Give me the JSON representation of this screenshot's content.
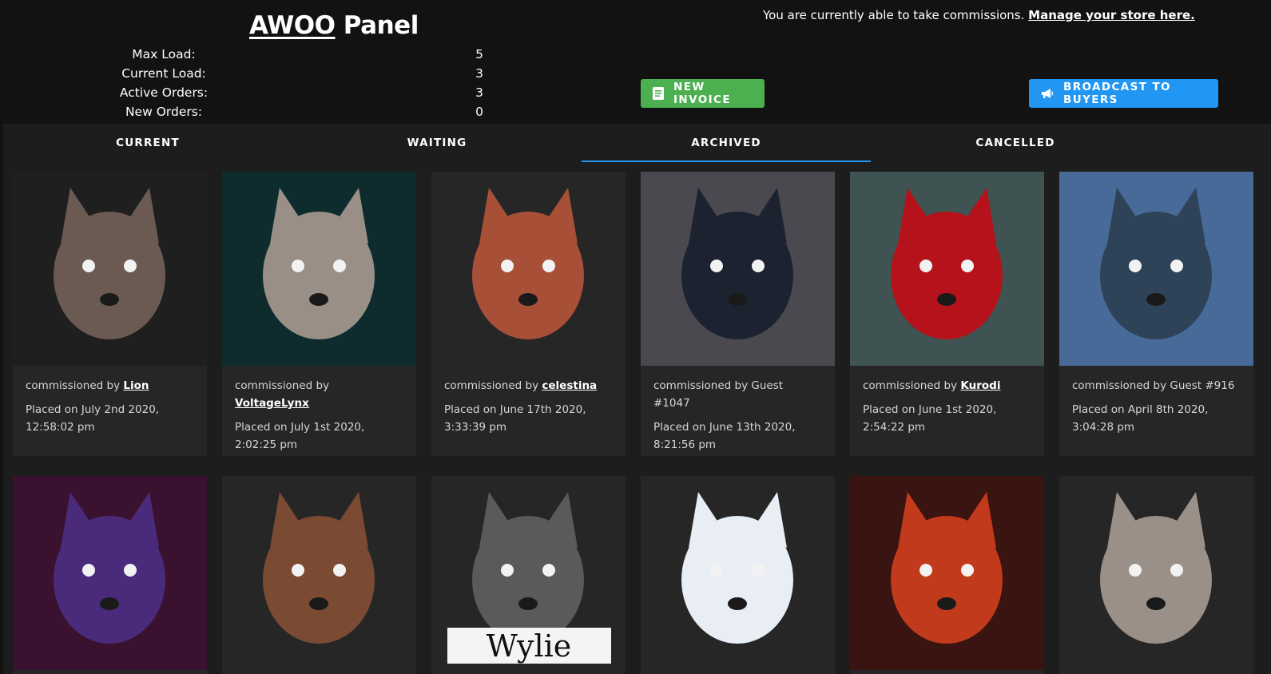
{
  "panel": {
    "brand": "AWOO",
    "title_suffix": " Panel"
  },
  "stats": [
    {
      "label": "Max Load:",
      "value": "5"
    },
    {
      "label": "Current Load:",
      "value": "3"
    },
    {
      "label": "Active Orders:",
      "value": "3"
    },
    {
      "label": "New Orders:",
      "value": "0"
    }
  ],
  "store": {
    "status_text": "You are currently able to take commissions.",
    "link_text": "Manage your store here."
  },
  "buttons": {
    "new_invoice": "NEW INVOICE",
    "broadcast": "BROADCAST TO BUYERS",
    "invoice_color": "#4caf50",
    "broadcast_color": "#2196f3"
  },
  "tabs": [
    {
      "label": "CURRENT",
      "active": false
    },
    {
      "label": "WAITING",
      "active": false
    },
    {
      "label": "ARCHIVED",
      "active": true
    },
    {
      "label": "CANCELLED",
      "active": false
    }
  ],
  "orders_row1": [
    {
      "prefix": "commissioned by",
      "buyer": "Lion",
      "is_guest": false,
      "placed": "Placed on July 2nd 2020, 12:58:02 pm",
      "art": "lion-portrait",
      "bg": "#1f1f1f",
      "fg": "#6b5a52"
    },
    {
      "prefix": "commissioned by",
      "buyer": "VoltageLynx",
      "is_guest": false,
      "placed": "Placed on July 1st 2020, 2:02:25 pm",
      "art": "lynx-portrait",
      "bg": "#0e2b2e",
      "fg": "#9a8f86"
    },
    {
      "prefix": "commissioned by",
      "buyer": "celestina",
      "is_guest": false,
      "placed": "Placed on June 17th 2020, 3:33:39 pm",
      "art": "red-blob-critter",
      "bg": "#262626",
      "fg": "#a84f37"
    },
    {
      "prefix": "commissioned by",
      "buyer": "Guest #1047",
      "is_guest": true,
      "placed": "Placed on June 13th 2020, 8:21:56 pm",
      "art": "ref-sheet-canine",
      "bg": "#4a4950",
      "fg": "#1d2230"
    },
    {
      "prefix": "commissioned by",
      "buyer": "Kurodi",
      "is_guest": false,
      "placed": "Placed on June 1st 2020, 2:54:22 pm",
      "art": "red-dragon-ref",
      "bg": "#3f5452",
      "fg": "#b5121b"
    },
    {
      "prefix": "commissioned by",
      "buyer": "Guest #916",
      "is_guest": true,
      "placed": "Placed on April 8th 2020, 3:04:28 pm",
      "art": "poodle-ref-sheet",
      "bg": "#476a99",
      "fg": "#2e4358"
    }
  ],
  "orders_row2": [
    {
      "art": "purple-bat-creature",
      "bg": "#3a1230",
      "fg": "#4a2a7a"
    },
    {
      "art": "brown-wolf-wink",
      "bg": "#262626",
      "fg": "#7a4a32"
    },
    {
      "art": "grey-wolf-wylie",
      "bg": "#262626",
      "fg": "#5a5a5a",
      "caption": "Wylie"
    },
    {
      "art": "white-polar-dog",
      "bg": "#262626",
      "fg": "#e8eef4"
    },
    {
      "art": "fire-dragon-city",
      "bg": "#3a1410",
      "fg": "#c23a1c"
    },
    {
      "art": "grey-fox-glasses",
      "bg": "#262626",
      "fg": "#9a9088"
    }
  ]
}
